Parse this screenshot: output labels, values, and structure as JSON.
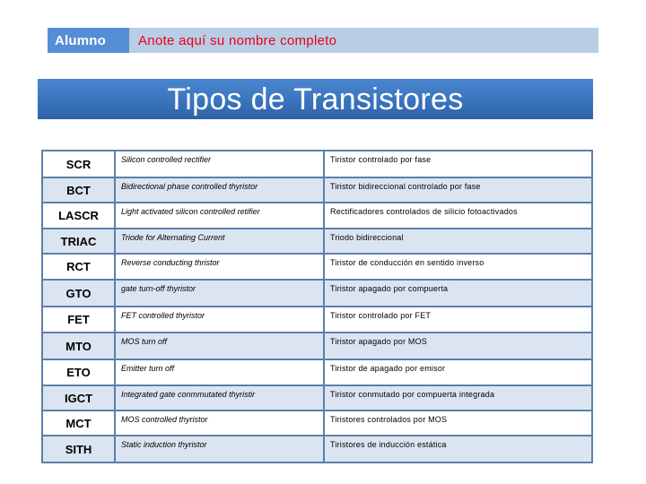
{
  "header": {
    "label": "Alumno",
    "name_placeholder": "Anote aquí su nombre completo"
  },
  "title": "Tipos de Transistores",
  "colors": {
    "label_bg": "#558ed5",
    "name_bar_bg": "#b9cde4",
    "name_text": "#e8001c",
    "title_bg": "#3a74bd",
    "row_alt_bg": "#dbe5f1",
    "border": "#5d7fa8"
  },
  "table": {
    "rows": [
      {
        "abbr": "SCR",
        "english": "Silicon controlled rectifier",
        "spanish": "Tiristor controlado por fase"
      },
      {
        "abbr": "BCT",
        "english": "Bidirectional phase controlled thyristor",
        "spanish": "Tiristor bidireccional controlado por fase"
      },
      {
        "abbr": "LASCR",
        "english": "Light activated silicon controlled retifier",
        "spanish": "Rectificadores controlados de silicio fotoactivados"
      },
      {
        "abbr": "TRIAC",
        "english": "Triode for Alternating Current",
        "spanish": "Triodo bidireccional"
      },
      {
        "abbr": "RCT",
        "english": "Reverse conducting thristor",
        "spanish": "Tiristor de conducción en sentido inverso"
      },
      {
        "abbr": "GTO",
        "english": "gate turn-off thyristor",
        "spanish": "Tiristor apagado por compuerta"
      },
      {
        "abbr": "FET",
        "english": "FET controlled thyristor",
        "spanish": "Tiristor controlado por FET"
      },
      {
        "abbr": "MTO",
        "english": "MOS turn off",
        "spanish": "Tiristor apagado por MOS"
      },
      {
        "abbr": "ETO",
        "english": "Emitter turn off",
        "spanish": "Tiristor de apagado por emisor"
      },
      {
        "abbr": "IGCT",
        "english": "Integrated gate conmmutated thyristir",
        "spanish": "Tiristor conmutado por compuerta integrada"
      },
      {
        "abbr": "MCT",
        "english": "MOS controlled thyristor",
        "spanish": "Tiristores controlados por MOS"
      },
      {
        "abbr": "SITH",
        "english": "Static induction thyristor",
        "spanish": "Tiristores de inducción estática"
      }
    ]
  }
}
